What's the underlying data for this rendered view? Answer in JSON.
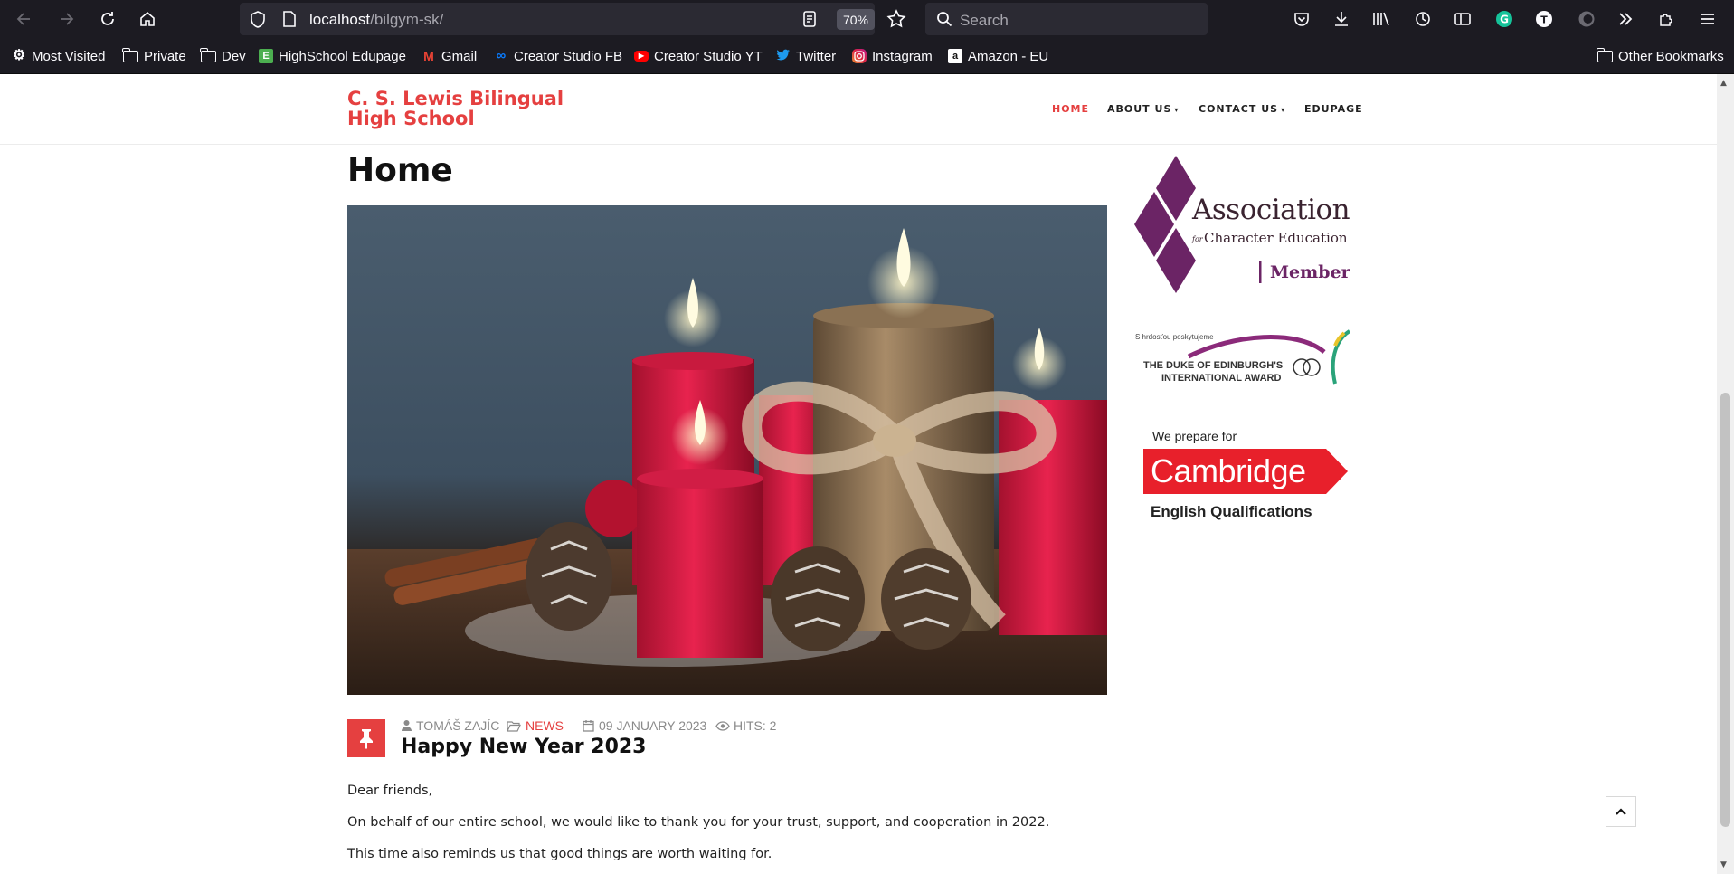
{
  "browser": {
    "url_host": "localhost",
    "url_path": "/bilgym-sk/",
    "zoom": "70%",
    "search_placeholder": "Search",
    "bookmarks": [
      {
        "label": "Most Visited",
        "icon": "gear-icon"
      },
      {
        "label": "Private",
        "icon": "folder-icon"
      },
      {
        "label": "Dev",
        "icon": "folder-icon"
      },
      {
        "label": "HighSchool Edupage",
        "icon": "edupage-icon"
      },
      {
        "label": "Gmail",
        "icon": "gmail-icon"
      },
      {
        "label": "Creator Studio FB",
        "icon": "meta-icon"
      },
      {
        "label": "Creator Studio YT",
        "icon": "youtube-icon"
      },
      {
        "label": "Twitter",
        "icon": "twitter-icon"
      },
      {
        "label": "Instagram",
        "icon": "instagram-icon"
      },
      {
        "label": "Amazon - EU",
        "icon": "amazon-icon"
      }
    ],
    "other_bookmarks": "Other Bookmarks"
  },
  "site": {
    "logo_line1": "C. S. Lewis Bilingual",
    "logo_line2": "High School",
    "nav": {
      "home": "HOME",
      "about": "ABOUT US",
      "contact": "CONTACT US",
      "edupage": "EDUPAGE"
    },
    "accent": "#e54040"
  },
  "main": {
    "page_title": "Home",
    "article": {
      "author": "TOMÁŠ ZAJÍC",
      "category": "NEWS",
      "date": "09 JANUARY 2023",
      "hits": "HITS: 2",
      "title": "Happy New Year 2023",
      "paragraphs": [
        "Dear friends,",
        "On behalf of our entire school, we would like to thank you for your trust, support, and cooperation in 2022.",
        "This time also reminds us that good things are worth waiting for."
      ]
    }
  },
  "sidebar": {
    "ace": {
      "line1": "Association",
      "for": "for",
      "line2": "Character Education",
      "member": "Member"
    },
    "duke": {
      "pre": "S hrdosťou poskytujeme",
      "line1": "THE DUKE OF EDINBURGH'S",
      "line2": "INTERNATIONAL AWARD"
    },
    "cambridge": {
      "pre": "We prepare for",
      "brand": "Cambridge",
      "sub": "English Qualifications"
    }
  }
}
